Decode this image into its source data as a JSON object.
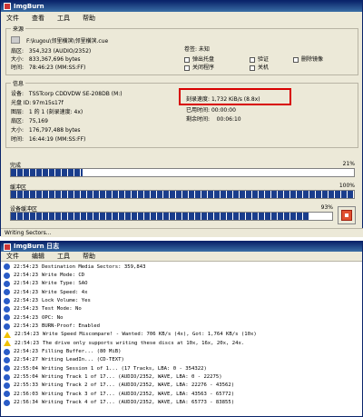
{
  "main_window": {
    "title": "ImgBurn",
    "menu": [
      "文件",
      "查看",
      "工具",
      "帮助"
    ],
    "source": {
      "title": "来源",
      "file": "F:\\kugou\\邻里横滨\\邻里横滨.cue",
      "sectors_label": "扇区:",
      "sectors": "354,323 (AUDIO/2352)",
      "size_label": "大小:",
      "size": "833,367,696 bytes",
      "time_label": "时间:",
      "time": "78:46:23 (MM:SS:FF)",
      "checkboxes": [
        {
          "label": "卷签: 未知"
        },
        {
          "label": "弹出托盘"
        },
        {
          "label": "关闭程序"
        },
        {
          "label": "验证"
        },
        {
          "label": "关机"
        },
        {
          "label": "删除镜像"
        }
      ]
    },
    "info": {
      "title": "信息",
      "device_label": "设备:",
      "device": "TSSTcorp CDDVDW SE-208DB (M:)",
      "disc_id_label": "光盘 ID:",
      "disc_id": "97m15s17f",
      "layer_label": "图层:",
      "layer": "1 的 1 (刻录速度: 4x)",
      "sectors_label": "扇区:",
      "sectors": "75,169",
      "size_label": "大小:",
      "size": "176,797,488 bytes",
      "time_label": "时间:",
      "time": "16:44:19 (MM:SS:FF)",
      "write_speed_label": "刻录速度:",
      "write_speed": "1,732 KiB/s (8.8x)",
      "elapsed_label": "已用时间:",
      "elapsed": "00:00:00",
      "remaining_label": "剩余时间:",
      "remaining": "00:06:10"
    },
    "progress": [
      {
        "label": "完成",
        "pct_text": "21%",
        "value": 0.21
      },
      {
        "label": "缓冲区",
        "pct_text": "100%",
        "value": 1.0
      },
      {
        "label": "设备缓冲区",
        "pct_text": "93%",
        "value": 0.93
      }
    ],
    "status": "Writing Sectors..."
  },
  "log_window": {
    "title": "ImgBurn 日志",
    "menu": [
      "文件",
      "编辑",
      "工具",
      "帮助"
    ],
    "entries": [
      {
        "icon": "info",
        "time": "22:54:23",
        "text": "Destination Media Sectors: 359,843"
      },
      {
        "icon": "info",
        "time": "22:54:23",
        "text": "Write Mode: CD"
      },
      {
        "icon": "info",
        "time": "22:54:23",
        "text": "Write Type: SAO"
      },
      {
        "icon": "info",
        "time": "22:54:23",
        "text": "Write Speed: 4x"
      },
      {
        "icon": "info",
        "time": "22:54:23",
        "text": "Lock Volume: Yes"
      },
      {
        "icon": "info",
        "time": "22:54:23",
        "text": "Test Mode: No"
      },
      {
        "icon": "info",
        "time": "22:54:23",
        "text": "OPC: No"
      },
      {
        "icon": "info",
        "time": "22:54:23",
        "text": "BURN-Proof: Enabled"
      },
      {
        "icon": "warn",
        "time": "22:54:23",
        "text": "Write Speed Miscompare! - Wanted: 706 KB/s (4x), Got: 1,764 KB/s (10x)"
      },
      {
        "icon": "warn",
        "time": "22:54:23",
        "text": "The drive only supports writing these discs at 10x, 16x, 20x, 24x."
      },
      {
        "icon": "info",
        "time": "22:54:23",
        "text": "Filling Buffer... (80 MiB)"
      },
      {
        "icon": "info",
        "time": "22:54:27",
        "text": "Writing LeadIn... (CD-TEXT)"
      },
      {
        "icon": "info",
        "time": "22:55:04",
        "text": "Writing Session 1 of 1... (17 Tracks, LBA: 0 - 354322)"
      },
      {
        "icon": "info",
        "time": "22:55:04",
        "text": "Writing Track 1 of 17... (AUDIO/2352, WAVE, LBA: 0 - 22275)"
      },
      {
        "icon": "info",
        "time": "22:55:33",
        "text": "Writing Track 2 of 17... (AUDIO/2352, WAVE, LBA: 22276 - 43562)"
      },
      {
        "icon": "info",
        "time": "22:56:03",
        "text": "Writing Track 3 of 17... (AUDIO/2352, WAVE, LBA: 43563 - 65772)"
      },
      {
        "icon": "info",
        "time": "22:56:34",
        "text": "Writing Track 4 of 17... (AUDIO/2352, WAVE, LBA: 65773 - 83855)"
      }
    ]
  }
}
